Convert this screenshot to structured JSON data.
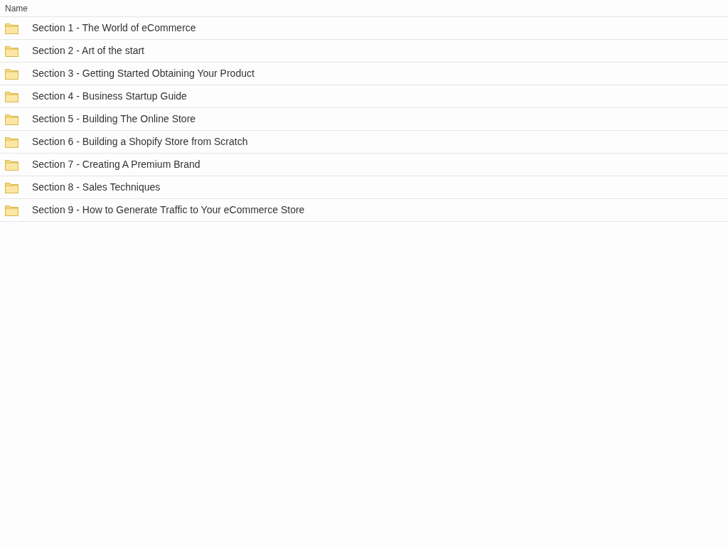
{
  "table": {
    "columns": [
      "Name"
    ],
    "rows": [
      {
        "kind": "folder",
        "name": "Section 1 - The World of eCommerce"
      },
      {
        "kind": "folder",
        "name": "Section 2 - Art of the start"
      },
      {
        "kind": "folder",
        "name": "Section 3 - Getting Started Obtaining Your Product"
      },
      {
        "kind": "folder",
        "name": "Section 4 - Business Startup Guide"
      },
      {
        "kind": "folder",
        "name": "Section 5 - Building The Online Store"
      },
      {
        "kind": "folder",
        "name": "Section 6 - Building a Shopify Store from Scratch"
      },
      {
        "kind": "folder",
        "name": "Section 7 - Creating A Premium Brand"
      },
      {
        "kind": "folder",
        "name": "Section 8 - Sales Techniques"
      },
      {
        "kind": "folder",
        "name": "Section 9 - How to Generate Traffic to Your eCommerce Store"
      }
    ]
  }
}
